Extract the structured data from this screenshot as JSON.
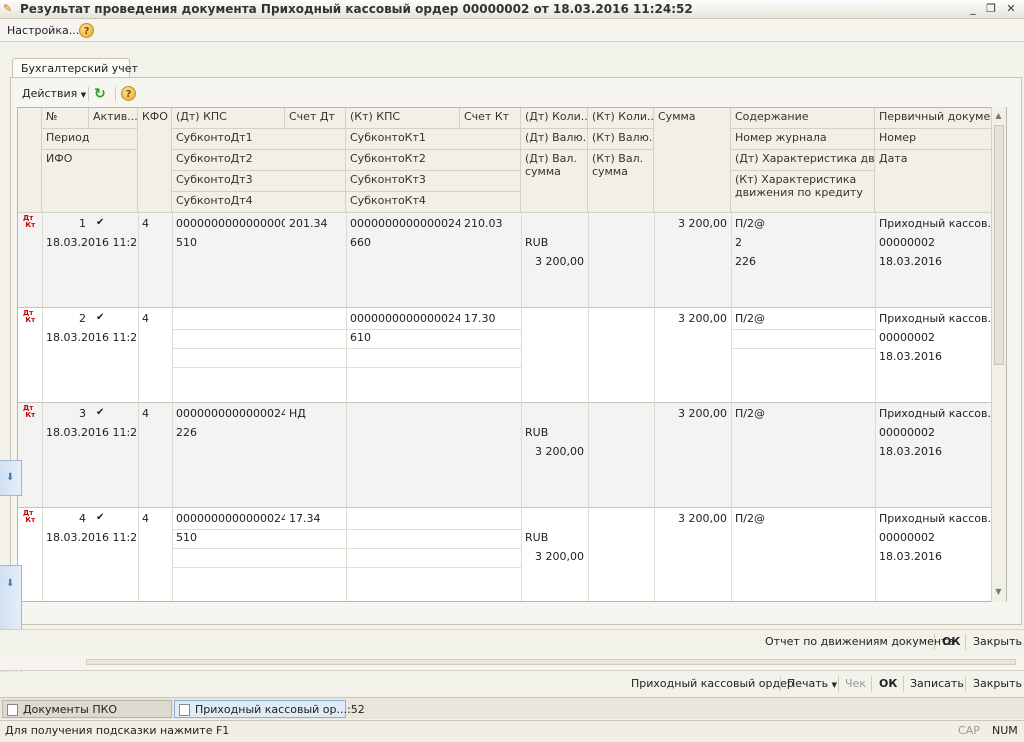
{
  "window": {
    "title": "Результат проведения документа Приходный кассовый ордер 00000002 от 18.03.2016 11:24:52"
  },
  "menu": {
    "settings_label": "Настройка...",
    "help_glyph": "?"
  },
  "tab": {
    "label": "Бухгалтерский учет"
  },
  "toolbar": {
    "actions_label": "Действия",
    "refresh_glyph": "↻",
    "help_glyph": "?"
  },
  "grid": {
    "headers": {
      "num": "№",
      "active": "Актив...",
      "kfo": "КФО",
      "dt_kps": "(Дт) КПС",
      "schet_dt": "Счет Дт",
      "kt_kps": "(Кт) КПС",
      "schet_kt": "Счет Кт",
      "dt_qty": "(Дт) Коли...",
      "kt_qty": "(Кт) Коли...",
      "sum": "Сумма",
      "content": "Содержание",
      "primary_doc": "Первичный докуме...",
      "period": "Период",
      "ifo": "ИФО",
      "subdt1": "СубконтоДт1",
      "subdt2": "СубконтоДт2",
      "subdt3": "СубконтоДт3",
      "subdt4": "СубконтоДт4",
      "subkt1": "СубконтоКт1",
      "subkt2": "СубконтоКт2",
      "subkt3": "СубконтоКт3",
      "subkt4": "СубконтоКт4",
      "dt_cur": "(Дт) Валю...",
      "kt_cur": "(Кт) Валю...",
      "dt_val_sum": "(Дт) Вал. сумма",
      "kt_val_sum": "(Кт) Вал. сумма",
      "journal": "Номер журнала",
      "dt_char": "(Дт) Характеристика дви...",
      "kt_char": "(Кт) Характеристика движения по кредиту",
      "number": "Номер",
      "date": "Дата"
    },
    "rows": [
      {
        "num": "1",
        "period": "18.03.2016 11:2...",
        "kfo": "4",
        "dt_kps": "00000000000000000",
        "schet_dt": "201.34",
        "dt_sub1": "510",
        "kt_kps": "00000000000000244",
        "schet_kt": "210.03",
        "kt_sub1": "660",
        "dt_cur": "RUB",
        "dt_val_sum": "3 200,00",
        "sum": "3 200,00",
        "content": "П/2@",
        "journal": "2",
        "dt_char": "226",
        "doc": "Приходный кассов...",
        "doc_num": "00000002",
        "doc_date": "18.03.2016"
      },
      {
        "num": "2",
        "period": "18.03.2016 11:2...",
        "kfo": "4",
        "dt_kps": "",
        "schet_dt": "",
        "dt_sub1": "",
        "kt_kps": "00000000000000244",
        "schet_kt": "17.30",
        "kt_sub1": "610",
        "dt_cur": "",
        "dt_val_sum": "",
        "sum": "3 200,00",
        "content": "П/2@",
        "journal": "",
        "dt_char": "",
        "doc": "Приходный кассов...",
        "doc_num": "00000002",
        "doc_date": "18.03.2016"
      },
      {
        "num": "3",
        "period": "18.03.2016 11:2...",
        "kfo": "4",
        "dt_kps": "00000000000000244",
        "schet_dt": "НД",
        "dt_sub1": "226",
        "kt_kps": "",
        "schet_kt": "",
        "kt_sub1": "",
        "dt_cur": "RUB",
        "dt_val_sum": "3 200,00",
        "sum": "3 200,00",
        "content": "П/2@",
        "journal": "",
        "dt_char": "",
        "doc": "Приходный кассов...",
        "doc_num": "00000002",
        "doc_date": "18.03.2016"
      },
      {
        "num": "4",
        "period": "18.03.2016 11:2...",
        "kfo": "4",
        "dt_kps": "00000000000000244",
        "schet_dt": "17.34",
        "dt_sub1": "510",
        "kt_kps": "",
        "schet_kt": "",
        "kt_sub1": "",
        "dt_cur": "RUB",
        "dt_val_sum": "3 200,00",
        "sum": "3 200,00",
        "content": "П/2@",
        "journal": "",
        "dt_char": "",
        "doc": "Приходный кассов...",
        "doc_num": "00000002",
        "doc_date": "18.03.2016"
      }
    ]
  },
  "dialog_buttons": {
    "report": "Отчет по движениям документа",
    "ok": "ОК",
    "close": "Закрыть"
  },
  "doc_buttons": {
    "pko": "Приходный кассовый ордер",
    "print": "Печать",
    "check": "Чек",
    "ok": "ОК",
    "save": "Записать",
    "close": "Закрыть"
  },
  "taskbar": {
    "item1": "Документы ПКО",
    "item2": "Приходный кассовый ор...:52"
  },
  "statusbar": {
    "hint": "Для получения подсказки нажмите F1",
    "cap": "CAP",
    "num": "NUM"
  },
  "icons": {
    "dtkt": "Дт/Кт",
    "check": "✔"
  }
}
